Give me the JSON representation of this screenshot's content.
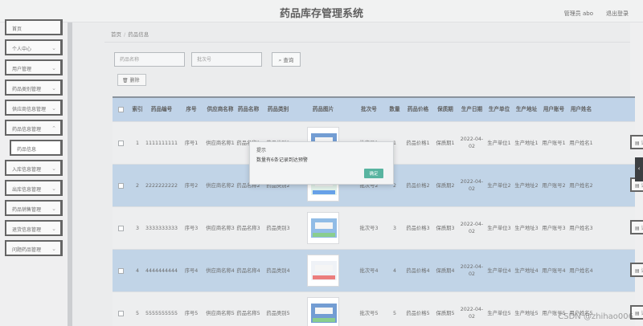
{
  "header": {
    "title": "药品库存管理系统",
    "user": "管理员 abo",
    "logout": "退出登录"
  },
  "sidebar": {
    "items": [
      {
        "label": "首页",
        "expandable": false,
        "sub": false
      },
      {
        "label": "个人中心",
        "expandable": true,
        "sub": false
      },
      {
        "label": "用户管理",
        "expandable": true,
        "sub": false
      },
      {
        "label": "药品类别管理",
        "expandable": true,
        "sub": false
      },
      {
        "label": "供应商信息管理",
        "expandable": true,
        "sub": false
      },
      {
        "label": "药品信息管理",
        "expandable": true,
        "sub": false
      },
      {
        "label": "药品信息",
        "expandable": false,
        "sub": true
      },
      {
        "label": "入库信息管理",
        "expandable": true,
        "sub": false
      },
      {
        "label": "出库信息管理",
        "expandable": true,
        "sub": false
      },
      {
        "label": "药品销售管理",
        "expandable": true,
        "sub": false
      },
      {
        "label": "退货信息管理",
        "expandable": true,
        "sub": false
      },
      {
        "label": "问题药品管理",
        "expandable": true,
        "sub": false
      }
    ]
  },
  "breadcrumb": {
    "home": "首页",
    "current": "药品信息"
  },
  "search": {
    "name_placeholder": "药品名称",
    "batch_placeholder": "批次号",
    "button": "查询"
  },
  "toolbar": {
    "delete": "删除"
  },
  "table": {
    "headers": [
      "",
      "索引",
      "药品编号",
      "序号",
      "供应商名称",
      "药品名称",
      "药品类别",
      "药品图片",
      "批次号",
      "数量",
      "药品价格",
      "保质期",
      "生产日期",
      "生产单位",
      "生产地址",
      "用户账号",
      "用户姓名"
    ],
    "rows": [
      [
        "",
        "1",
        "1111111111",
        "序号1",
        "供应商名称1",
        "药品名称1",
        "药品类别1",
        "",
        "批次号1",
        "1",
        "药品价格1",
        "保质期1",
        "2022-04-02",
        "生产单位1",
        "生产地址1",
        "用户账号1",
        "用户姓名1"
      ],
      [
        "",
        "2",
        "2222222222",
        "序号2",
        "供应商名称2",
        "药品名称2",
        "药品类别2",
        "",
        "批次号2",
        "2",
        "药品价格2",
        "保质期2",
        "2022-04-02",
        "生产单位2",
        "生产地址2",
        "用户账号2",
        "用户姓名2"
      ],
      [
        "",
        "3",
        "3333333333",
        "序号3",
        "供应商名称3",
        "药品名称3",
        "药品类别3",
        "",
        "批次号3",
        "3",
        "药品价格3",
        "保质期3",
        "2022-04-02",
        "生产单位3",
        "生产地址3",
        "用户账号3",
        "用户姓名3"
      ],
      [
        "",
        "4",
        "4444444444",
        "序号4",
        "供应商名称4",
        "药品名称4",
        "药品类别4",
        "",
        "批次号4",
        "4",
        "药品价格4",
        "保质期4",
        "2022-04-02",
        "生产单位4",
        "生产地址4",
        "用户账号4",
        "用户姓名4"
      ],
      [
        "",
        "5",
        "5555555555",
        "序号5",
        "供应商名称5",
        "药品名称5",
        "药品类别5",
        "",
        "批次号5",
        "5",
        "药品价格5",
        "保质期5",
        "2022-04-02",
        "生产单位5",
        "生产地址5",
        "用户账号5",
        "用户姓名5"
      ]
    ],
    "detail_label": "详"
  },
  "dialog": {
    "title": "提示",
    "message": "数量有6条记录到达预警",
    "confirm": "确定"
  },
  "colors": {
    "header_row": "#a8c3df",
    "alt_row": "#aac4de",
    "confirm_button": "#58b4a0"
  },
  "watermark": "CSDN @zhihao006"
}
